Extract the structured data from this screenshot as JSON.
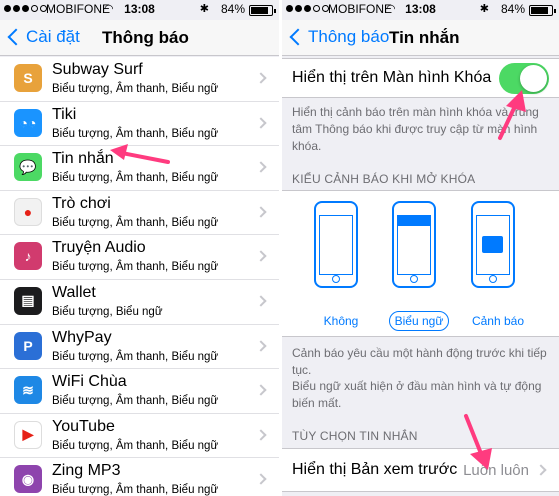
{
  "left": {
    "status": {
      "carrier": "MOBIFONE",
      "time": "13:08",
      "battery": "84%",
      "battery_level": 0.84
    },
    "nav": {
      "back_label": "Cài đặt",
      "title": "Thông báo"
    },
    "apps": [
      {
        "name": "Subway Surf",
        "sub": "Biểu tượng, Âm thanh, Biểu ngữ",
        "icon": "subway-surf-icon",
        "color": "#e8a23b",
        "glyph": "S"
      },
      {
        "name": "Tiki",
        "sub": "Biểu tượng, Âm thanh, Biểu ngữ",
        "icon": "tiki-icon",
        "color": "#1a94ff",
        "glyph": "◔◔"
      },
      {
        "name": "Tin nhắn",
        "sub": "Biểu tượng, Âm thanh, Biểu ngữ",
        "icon": "messages-icon",
        "color": "#4cd964",
        "glyph": "💬"
      },
      {
        "name": "Trò chơi",
        "sub": "Biểu tượng, Âm thanh, Biểu ngữ",
        "icon": "game-center-icon",
        "color": "#f2f2f2",
        "glyph": "●"
      },
      {
        "name": "Truyện Audio",
        "sub": "Biểu tượng, Âm thanh, Biểu ngữ",
        "icon": "truyen-audio-icon",
        "color": "#d13b6e",
        "glyph": "♪"
      },
      {
        "name": "Wallet",
        "sub": "Biểu tượng, Biểu ngữ",
        "icon": "wallet-icon",
        "color": "#1c1c1e",
        "glyph": "▤"
      },
      {
        "name": "WhyPay",
        "sub": "Biểu tượng, Âm thanh, Biểu ngữ",
        "icon": "whypay-icon",
        "color": "#2b6fd6",
        "glyph": "P"
      },
      {
        "name": "WiFi Chùa",
        "sub": "Biểu tượng, Âm thanh, Biểu ngữ",
        "icon": "wifi-chua-icon",
        "color": "#1e88e5",
        "glyph": "≋"
      },
      {
        "name": "YouTube",
        "sub": "Biểu tượng, Âm thanh, Biểu ngữ",
        "icon": "youtube-icon",
        "color": "#ffffff",
        "glyph": "▶"
      },
      {
        "name": "Zing MP3",
        "sub": "Biểu tượng, Âm thanh, Biểu ngữ",
        "icon": "zing-mp3-icon",
        "color": "#8e44ad",
        "glyph": "◉"
      }
    ]
  },
  "right": {
    "status": {
      "carrier": "MOBIFONE",
      "time": "13:08",
      "battery": "84%",
      "battery_level": 0.84
    },
    "nav": {
      "back_label": "Thông báo",
      "title": "Tin nhắn"
    },
    "lock_screen": {
      "label": "Hiển thị trên Màn hình Khóa",
      "enabled": true
    },
    "lock_footer": "Hiển thị cảnh báo trên màn hình khóa và trung tâm Thông báo khi được truy cập từ màn hình khóa.",
    "alert_style_header": "KIỂU CẢNH BÁO KHI MỞ KHÓA",
    "styles": [
      {
        "label": "Không",
        "selected": false
      },
      {
        "label": "Biểu ngữ",
        "selected": true
      },
      {
        "label": "Cảnh báo",
        "selected": false
      }
    ],
    "style_footer_1": "Cảnh báo yêu cầu một hành động trước khi tiếp tục.",
    "style_footer_2": "Biểu ngữ xuất hiện ở đầu màn hình và tự động biến mất.",
    "message_options_header": "TÙY CHỌN TIN NHẮN",
    "preview": {
      "label": "Hiển thị Bản xem trước",
      "value": "Luôn luôn"
    },
    "colors": {
      "accent": "#007aff",
      "toggle_on": "#4cd964",
      "annotation_arrow": "#ff3b7f"
    }
  }
}
